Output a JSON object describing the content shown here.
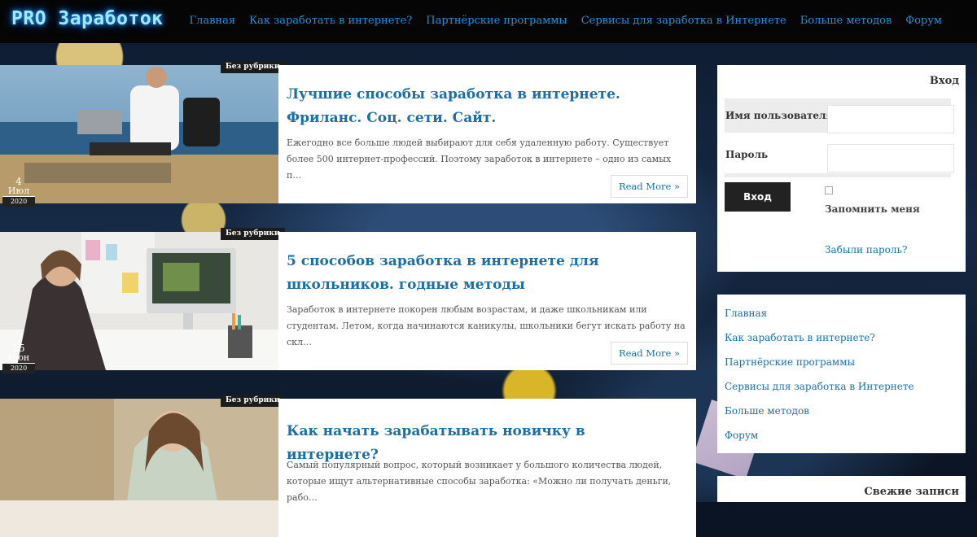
{
  "site": {
    "logo": "PRO Заработок"
  },
  "nav": [
    "Главная",
    "Как заработать в интернете?",
    "Партнёрские программы",
    "Сервисы для заработка в Интернете",
    "Больше методов",
    "Форум"
  ],
  "posts": [
    {
      "category": "Без рубрики",
      "day": "4",
      "month": "Июл",
      "year": "2020",
      "title": "Лучшие способы заработка в интернете. Фриланс. Соц. сети. Сайт.",
      "excerpt": "Ежегодно все больше людей выбирают для себя удаленную работу. Существует более 500 интернет-профессий. Поэтому заработок в интернете – одно из самых п…",
      "read_more": "Read More »"
    },
    {
      "category": "Без рубрики",
      "day": "25",
      "month": "Июн",
      "year": "2020",
      "title": "5 способов заработка в интернете для школьников. годные методы",
      "excerpt": "Заработок в интернете покорен любым возрастам, и даже школьникам или студентам. Летом, когда начинаются каникулы, школьники бегут искать работу на скл…",
      "read_more": "Read More »"
    },
    {
      "category": "Без рубрики",
      "title": "Как начать зарабатывать новичку в интернете?",
      "excerpt": "Самый популярный вопрос, который возникает у большого количества людей, которые ищут альтернативные способы заработка: «Можно ли получать деньги, рабо…"
    }
  ],
  "login": {
    "title": "Вход",
    "username_label": "Имя пользователя",
    "username_value": "",
    "password_label": "Пароль",
    "password_value": "",
    "submit": "Вход",
    "remember": "Запомнить меня",
    "remember_checked": false,
    "forgot": "Забыли пароль?"
  },
  "sidebar_menu": [
    "Главная",
    "Как заработать в интернете?",
    "Партнёрские программы",
    "Сервисы для заработка в Интернете",
    "Больше методов",
    "Форум"
  ],
  "recent": {
    "title": "Свежие записи"
  },
  "colors": {
    "link": "#1c6fa6",
    "header_bg": "#050505",
    "logo_glow": "#2aa8ff"
  }
}
